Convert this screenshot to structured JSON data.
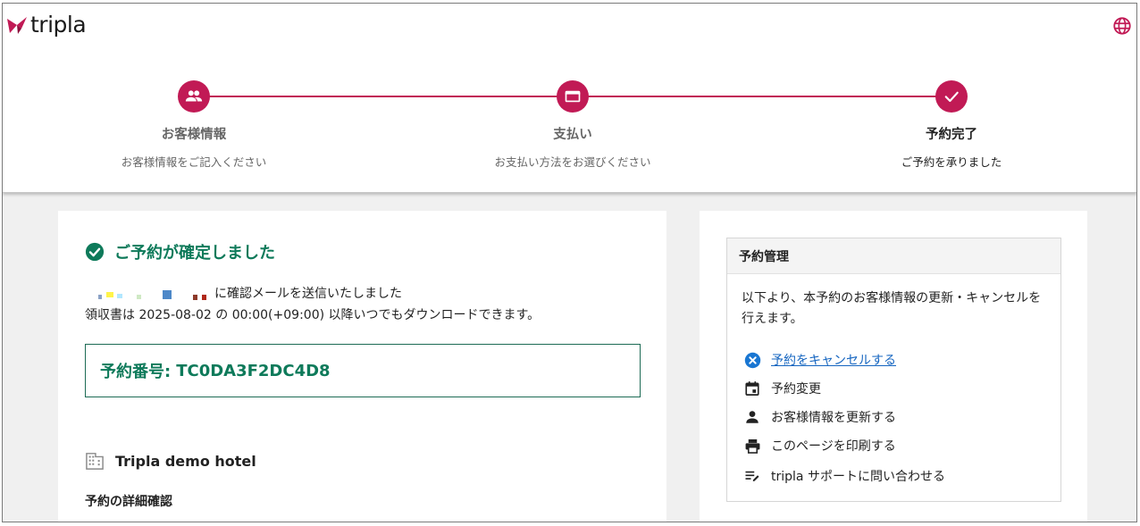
{
  "app": {
    "brand": "tripla"
  },
  "colors": {
    "accent": "#c11a55",
    "success": "#0e7a5a",
    "link": "#1565c0"
  },
  "steps": [
    {
      "title": "お客様情報",
      "subtitle": "お客様情報をご記入ください",
      "icon": "people-icon"
    },
    {
      "title": "支払い",
      "subtitle": "お支払い方法をお選びください",
      "icon": "credit-card-icon"
    },
    {
      "title": "予約完了",
      "subtitle": "ご予約を承りました",
      "icon": "check-icon"
    }
  ],
  "confirmation": {
    "title": "ご予約が確定しました",
    "mail_sent_suffix": "に確認メールを送信いたしました",
    "receipt_note": "領収書は 2025-08-02 の 00:00(+09:00) 以降いつでもダウンロードできます。",
    "booking_label": "予約番号:",
    "booking_number": "TC0DA3F2DC4D8"
  },
  "hotel": {
    "name": "Tripla demo hotel"
  },
  "details": {
    "heading": "予約の詳細確認"
  },
  "management": {
    "heading": "予約管理",
    "description": "以下より、本予約のお客様情報の更新・キャンセルを行えます。",
    "actions": [
      {
        "label": "予約をキャンセルする",
        "icon": "cancel-icon"
      },
      {
        "label": "予約変更",
        "icon": "calendar-icon"
      },
      {
        "label": "お客様情報を更新する",
        "icon": "person-icon"
      },
      {
        "label": "このページを印刷する",
        "icon": "print-icon"
      },
      {
        "label": "tripla サポートに問い合わせる",
        "icon": "support-icon"
      }
    ]
  }
}
